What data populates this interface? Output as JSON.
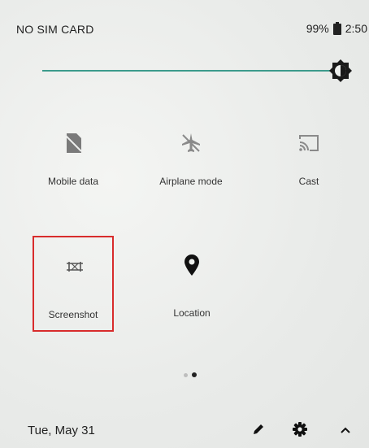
{
  "status_bar": {
    "carrier": "NO SIM CARD",
    "battery": "99%",
    "time": "2:50"
  },
  "brightness": {
    "level": 1.0,
    "track_color": "#3c9b8c"
  },
  "tiles": [
    {
      "label": "Mobile data",
      "icon": "sim-card-off-icon"
    },
    {
      "label": "Airplane mode",
      "icon": "airplane-off-icon"
    },
    {
      "label": "Cast",
      "icon": "cast-icon"
    },
    {
      "label": "Screenshot",
      "icon": "screenshot-icon",
      "highlight_color": "#d82c2c"
    },
    {
      "label": "Location",
      "icon": "location-pin-icon"
    }
  ],
  "pager": {
    "pages": 2,
    "current": 2
  },
  "footer": {
    "date": "Tue, May 31",
    "buttons": [
      "edit-icon",
      "settings-icon",
      "chevron-up-icon"
    ]
  }
}
